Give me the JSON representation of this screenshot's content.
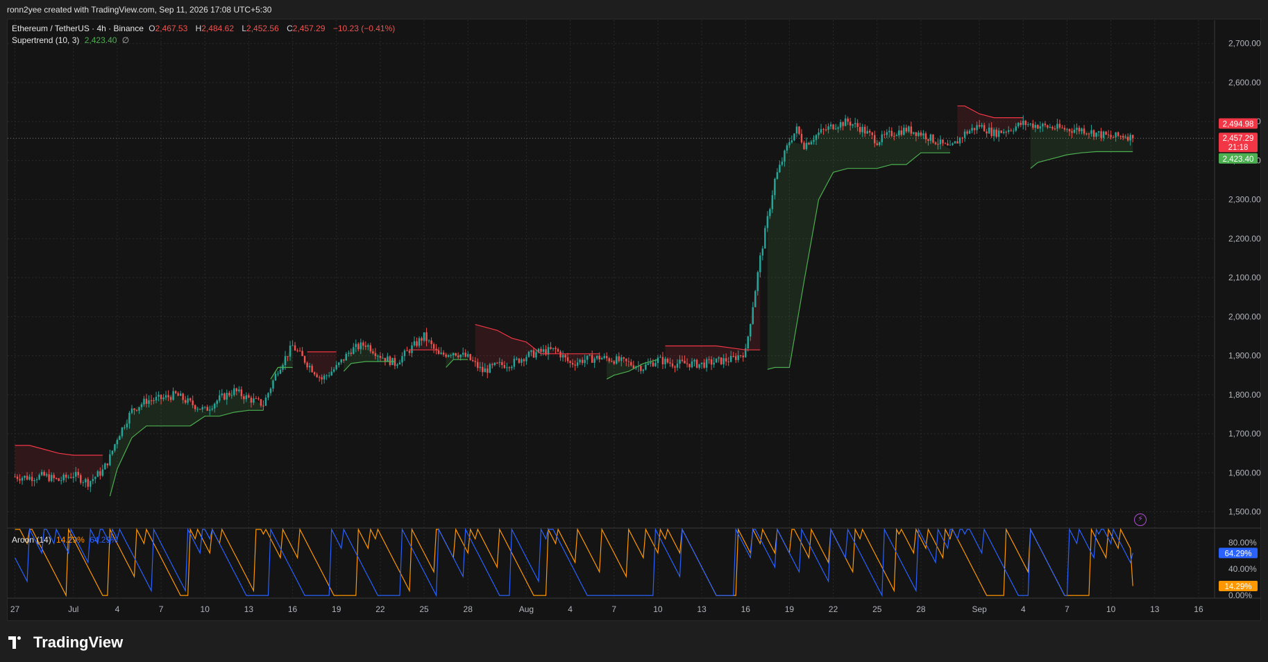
{
  "header": {
    "caption": "ronn2yee created with TradingView.com, Sep 11, 2026 17:08 UTC+5:30"
  },
  "legend": {
    "symbol": "Ethereum / TetherUS · 4h · Binance",
    "o_label": "O",
    "o_value": "2,467.53",
    "h_label": "H",
    "h_value": "2,484.62",
    "l_label": "L",
    "l_value": "2,452.56",
    "c_label": "C",
    "c_value": "2,457.29",
    "change": "−10.23 (−0.41%)",
    "supertrend_label": "Supertrend (10, 3)",
    "supertrend_value": "2,423.40",
    "supertrend_suffix": "∅"
  },
  "aroon_legend": {
    "label": "Aroon (14)",
    "up_value": "14.29%",
    "down_value": "64.29%"
  },
  "price_badges": {
    "upper": "2,494.98",
    "current": "2,457.29",
    "countdown": "21:18",
    "supertrend": "2,423.40"
  },
  "aroon_badges": {
    "down": "64.29%",
    "up": "14.29%"
  },
  "footer": {
    "brand": "TradingView"
  },
  "colors": {
    "up": "#26a69a",
    "down": "#ef5350",
    "supertrend_up": "#4caf50",
    "supertrend_down": "#f23645",
    "aroon_up": "#ff9800",
    "aroon_down": "#2962ff"
  },
  "chart_data": [
    {
      "type": "candlestick",
      "title": "Ethereum / TetherUS · 4h · Binance",
      "y_axis": {
        "ticks": [
          "2,700.00",
          "2,600.00",
          "2,500.00",
          "2,400.00",
          "2,300.00",
          "2,200.00",
          "2,100.00",
          "2,000.00",
          "1,900.00",
          "1,800.00",
          "1,700.00",
          "1,600.00",
          "1,500.00"
        ],
        "tick_values": [
          2700,
          2600,
          2500,
          2400,
          2300,
          2200,
          2100,
          2000,
          1900,
          1800,
          1700,
          1600,
          1500
        ],
        "range": [
          1460,
          2760
        ]
      },
      "x_axis": {
        "ticks": [
          "27",
          "Jul",
          "4",
          "7",
          "10",
          "13",
          "16",
          "19",
          "22",
          "25",
          "28",
          "Aug",
          "4",
          "7",
          "10",
          "13",
          "16",
          "19",
          "22",
          "25",
          "28",
          "Sep",
          "4",
          "7",
          "10",
          "13",
          "16"
        ],
        "tick_days": [
          0,
          4,
          7,
          10,
          13,
          16,
          19,
          22,
          25,
          28,
          31,
          35,
          38,
          41,
          44,
          47,
          50,
          53,
          56,
          59,
          62,
          66,
          69,
          72,
          75,
          78,
          81
        ],
        "range_days": [
          -0.5,
          82
        ]
      },
      "close_series_days": [
        0,
        1,
        2,
        3,
        4,
        5,
        6,
        6.5,
        7,
        8,
        9,
        10,
        11,
        12,
        13,
        14,
        15,
        16,
        17,
        18,
        19,
        20,
        21,
        22,
        23,
        24,
        25,
        26,
        27,
        28,
        29,
        30,
        31,
        32,
        33,
        34,
        35,
        36,
        37,
        38,
        39,
        40,
        41,
        42,
        43,
        44,
        45,
        46,
        47,
        48,
        49,
        50,
        51,
        52,
        53,
        53.5,
        54,
        55,
        56,
        57,
        58,
        59,
        60,
        61,
        62,
        63,
        64,
        65,
        66,
        67,
        68,
        69,
        70,
        71,
        72,
        73,
        74,
        75,
        76,
        76.5
      ],
      "close_series": [
        1590,
        1588,
        1592,
        1580,
        1595,
        1575,
        1605,
        1640,
        1690,
        1760,
        1785,
        1790,
        1800,
        1778,
        1760,
        1790,
        1810,
        1790,
        1775,
        1865,
        1925,
        1880,
        1840,
        1870,
        1915,
        1930,
        1900,
        1880,
        1915,
        1950,
        1900,
        1910,
        1895,
        1860,
        1875,
        1880,
        1900,
        1910,
        1915,
        1880,
        1890,
        1895,
        1890,
        1880,
        1870,
        1890,
        1880,
        1880,
        1878,
        1885,
        1890,
        1910,
        2150,
        2350,
        2450,
        2480,
        2440,
        2470,
        2490,
        2500,
        2480,
        2450,
        2470,
        2480,
        2470,
        2450,
        2430,
        2470,
        2490,
        2470,
        2480,
        2495,
        2490,
        2485,
        2480,
        2480,
        2470,
        2460,
        2465,
        2457
      ],
      "supertrend": {
        "label": "Supertrend (10, 3)",
        "last_value": 2423.4,
        "segments": [
          {
            "direction": "down",
            "days": [
              0,
              1,
              2,
              3,
              4,
              5,
              6
            ],
            "values": [
              1670,
              1670,
              1660,
              1650,
              1645,
              1645,
              1645
            ]
          },
          {
            "direction": "up",
            "days": [
              6.5,
              7,
              8,
              9,
              10,
              11,
              12,
              13,
              14,
              15,
              16,
              17
            ],
            "values": [
              1540,
              1610,
              1690,
              1720,
              1720,
              1720,
              1720,
              1745,
              1745,
              1755,
              1760,
              1760
            ]
          },
          {
            "direction": "up",
            "days": [
              17.5,
              18,
              19
            ],
            "values": [
              1840,
              1870,
              1870
            ]
          },
          {
            "direction": "down",
            "days": [
              20,
              21,
              22
            ],
            "values": [
              1910,
              1910,
              1910
            ]
          },
          {
            "direction": "up",
            "days": [
              22.5,
              23,
              24,
              25,
              26
            ],
            "values": [
              1860,
              1880,
              1885,
              1885,
              1885
            ]
          },
          {
            "direction": "down",
            "days": [
              27,
              28,
              29
            ],
            "values": [
              1915,
              1915,
              1915
            ]
          },
          {
            "direction": "up",
            "days": [
              29.5,
              30,
              31
            ],
            "values": [
              1870,
              1890,
              1890
            ]
          },
          {
            "direction": "down",
            "days": [
              31.5,
              32,
              33,
              34,
              35,
              36,
              37,
              38,
              39,
              40
            ],
            "values": [
              1980,
              1975,
              1965,
              1945,
              1935,
              1905,
              1905,
              1905,
              1905,
              1905
            ]
          },
          {
            "direction": "up",
            "days": [
              40.5,
              41,
              42,
              43,
              44
            ],
            "values": [
              1840,
              1850,
              1860,
              1880,
              1890
            ]
          },
          {
            "direction": "down",
            "days": [
              44.5,
              45,
              46,
              47,
              48,
              49,
              50,
              51
            ],
            "values": [
              1925,
              1925,
              1925,
              1925,
              1925,
              1920,
              1915,
              1915
            ]
          },
          {
            "direction": "up",
            "days": [
              51.5,
              52,
              53,
              54,
              55,
              56,
              57,
              58,
              59,
              60,
              61,
              62,
              63,
              64
            ],
            "values": [
              1865,
              1870,
              1870,
              2090,
              2300,
              2370,
              2380,
              2380,
              2380,
              2390,
              2390,
              2420,
              2420,
              2420
            ]
          },
          {
            "direction": "down",
            "days": [
              64.5,
              65,
              66,
              67,
              68,
              69
            ],
            "values": [
              2540,
              2540,
              2520,
              2510,
              2510,
              2510
            ]
          },
          {
            "direction": "up",
            "days": [
              69.5,
              70,
              71,
              72,
              73,
              74,
              75,
              76,
              76.5
            ],
            "values": [
              2380,
              2395,
              2405,
              2415,
              2420,
              2423,
              2423,
              2423,
              2423
            ]
          }
        ]
      },
      "last_close": 2457.29
    },
    {
      "type": "line",
      "title": "Aroon (14)",
      "y_axis": {
        "ticks": [
          "80.00%",
          "40.00%",
          "0.00%"
        ],
        "tick_values": [
          80,
          40,
          0
        ],
        "range": [
          -2,
          102
        ]
      },
      "series": [
        {
          "name": "Aroon Up",
          "last_value": 14.29
        },
        {
          "name": "Aroon Down",
          "last_value": 64.29
        }
      ]
    }
  ]
}
